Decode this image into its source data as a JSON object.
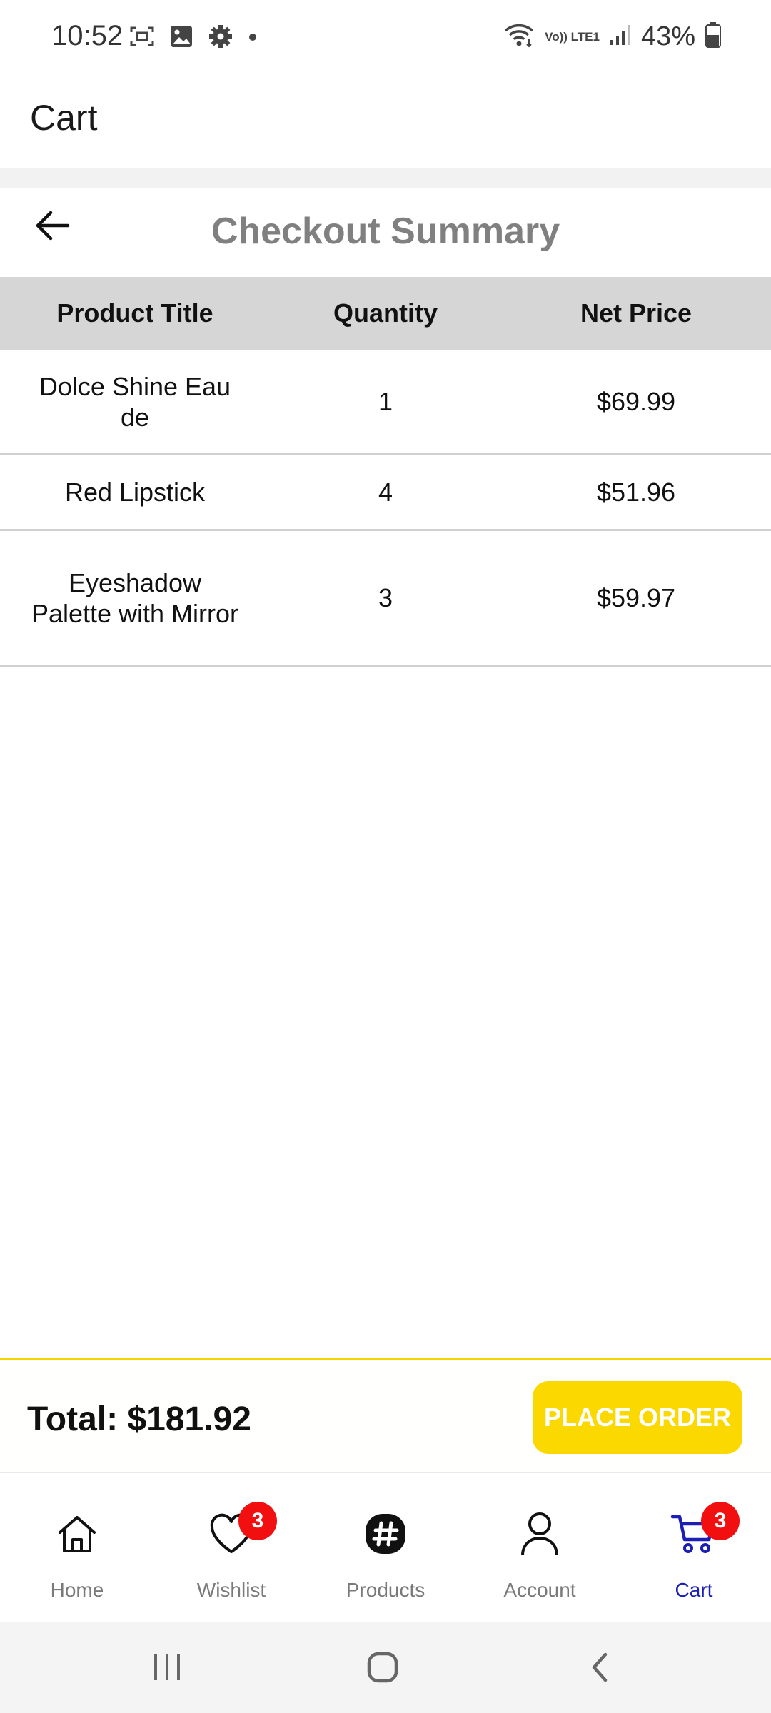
{
  "status_bar": {
    "time": "10:52",
    "battery": "43%",
    "network_label": "Vo)) LTE1"
  },
  "app_bar": {
    "title": "Cart"
  },
  "summary": {
    "title": "Checkout Summary"
  },
  "table": {
    "headers": [
      "Product Title",
      "Quantity",
      "Net Price"
    ],
    "rows": [
      {
        "title": "Dolce Shine Eau de",
        "quantity": "1",
        "price": "$69.99"
      },
      {
        "title": "Red Lipstick",
        "quantity": "4",
        "price": "$51.96"
      },
      {
        "title": "Eyeshadow Palette with Mirror",
        "quantity": "3",
        "price": "$59.97"
      }
    ]
  },
  "checkout": {
    "total": "Total: $181.92",
    "place_order_label": "PLACE ORDER"
  },
  "nav": {
    "items": [
      {
        "label": "Home",
        "icon": "home-icon"
      },
      {
        "label": "Wishlist",
        "icon": "heart-icon",
        "badge": "3"
      },
      {
        "label": "Products",
        "icon": "hashtag-icon"
      },
      {
        "label": "Account",
        "icon": "person-icon"
      },
      {
        "label": "Cart",
        "icon": "cart-icon",
        "badge": "3",
        "active": true
      }
    ]
  },
  "colors": {
    "accent": "#fbd900",
    "active_nav": "#1b1fb5",
    "badge": "#f20f0f",
    "title_gray": "#808080"
  }
}
